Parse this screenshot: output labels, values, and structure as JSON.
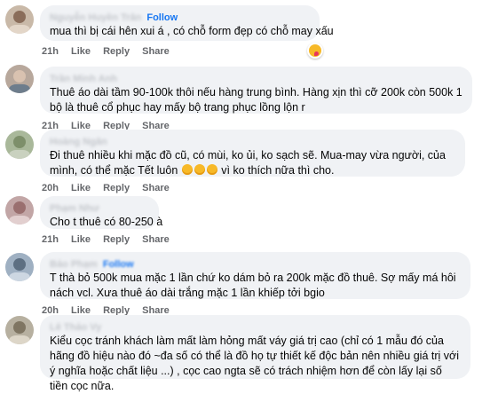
{
  "comments": [
    {
      "author": "Nguyễn Huyền Trân",
      "follow": "Follow",
      "text": "mua thì bị cái hên xui á , có chỗ form đẹp có chỗ may xấu",
      "time": "21h",
      "reaction": "laughing-face-icon"
    },
    {
      "author": "Trần Minh Anh",
      "text": "Thuê áo dài tầm 90-100k thôi nếu hàng trung bình. Hàng xịn thì cỡ 200k còn 500k 1 bộ là thuê cổ phục hay mấy bộ trang phục lồng lộn r",
      "time": "21h"
    },
    {
      "author": "Hoàng Ngân",
      "text_before": "Đi thuê nhiều khi mặc đồ cũ, có mùi, ko ủi, ko sạch sẽ. Mua-may vừa người, của mình, có thể mặc Tết luôn",
      "text_after": "vì ko thích nữa thì cho.",
      "time": "20h"
    },
    {
      "author": "Phạm Như",
      "text": "Cho t thuê có 80-250 à",
      "time": "21h"
    },
    {
      "author": "Bảo Phạm",
      "follow": "Follow",
      "text": "T thà bỏ 500k mua mặc 1 lần chứ ko dám bỏ ra 200k mặc đồ thuê. Sợ mấy má hôi nách vcl. Xưa thuê áo dài trắng mặc 1 lần khiếp tởi bgio",
      "time": "20h"
    },
    {
      "author": "Lê Thảo Vy",
      "text": "Kiểu cọc tránh khách làm mất làm hỏng mất váy giá trị cao (chỉ có 1 mẫu đó của hãng đồ hiệu nào đó ~đa số có thể là đồ họ tự thiết kế độc bản nên nhiều giá trị với ý nghĩa hoặc chất liệu ...) , cọc cao ngta sẽ có trách nhiệm hơn để còn lấy lại số tiền cọc nữa.",
      "time": ""
    }
  ],
  "actions": {
    "like": "Like",
    "reply": "Reply",
    "share": "Share"
  }
}
